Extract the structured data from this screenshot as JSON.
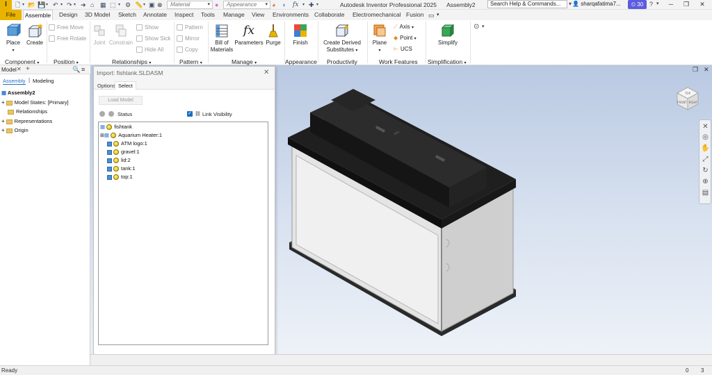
{
  "app": {
    "logo": "I",
    "title": "Autodesk Inventor Professional 2025",
    "document": "Assembly2",
    "search_placeholder": "Search Help & Commands...",
    "user": "sharqafatima7...",
    "notifications": "30"
  },
  "quick_access": {
    "material": "Material",
    "appearance": "Appearance"
  },
  "tabs": [
    "File",
    "Assemble",
    "Design",
    "3D Model",
    "Sketch",
    "Annotate",
    "Inspect",
    "Tools",
    "Manage",
    "View",
    "Environments",
    "Collaborate",
    "Electromechanical",
    "Fusion"
  ],
  "ribbon": {
    "place": "Place",
    "create": "Create",
    "free_move": "Free Move",
    "free_rotate": "Free Rotate",
    "joint": "Joint",
    "constrain": "Constrain",
    "show": "Show",
    "show_sick": "Show Sick",
    "hide_all": "Hide All",
    "pattern": "Pattern",
    "mirror": "Mirror",
    "copy": "Copy",
    "bill_of_materials": [
      "Bill of",
      "Materials"
    ],
    "parameters": "Parameters",
    "purge": "Purge",
    "finish": "Finish",
    "create_derived": [
      "Create Derived",
      "Substitutes"
    ],
    "plane": "Plane",
    "axis": "Axis",
    "point": "Point",
    "ucs": "UCS",
    "simplify": "Simplify",
    "groups": {
      "component": "Component",
      "position": "Position",
      "relationships": "Relationships",
      "pattern": "Pattern",
      "manage": "Manage",
      "appearance": "Appearance",
      "productivity": "Productivity",
      "work_features": "Work Features",
      "simplification": "Simplification"
    }
  },
  "browser": {
    "title": "Model",
    "tab_assembly": "Assembly",
    "tab_modeling": "Modeling",
    "root": "Assembly2",
    "nodes": [
      "Model States: [Primary]",
      "Relationships",
      "Representations",
      "Origin"
    ]
  },
  "dialog": {
    "title": "Import: fishtank.SLDASM",
    "tab_options": "Options",
    "tab_select": "Select",
    "load_model": "Load Model",
    "status_label": "Status",
    "link_visibility": "Link Visibility",
    "root": "fishtank",
    "items": [
      "Aquarium Heater:1",
      "ATM logo:1",
      "gravel:1",
      "lid:2",
      "tank:1",
      "top:1"
    ]
  },
  "viewcube": {
    "top": "TOP",
    "front": "FRONT",
    "right": "RIGHT"
  },
  "status": {
    "text": "Ready",
    "count_a": "0",
    "count_b": "3"
  },
  "colors": {
    "file_tab": "#e8b400",
    "accent": "#1a6fc2",
    "badge": "#5c5ce0"
  }
}
